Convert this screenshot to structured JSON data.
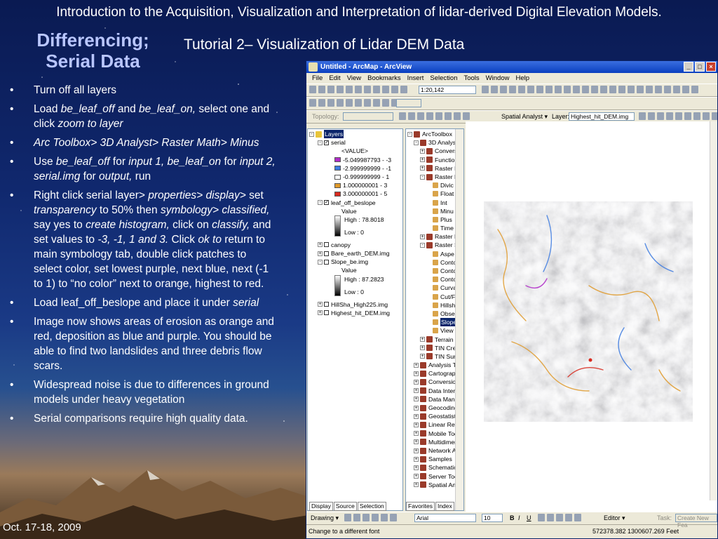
{
  "slide": {
    "top_title": "Introduction to the Acquisition, Visualization and Interpretation of lidar-derived Digital Elevation Models.",
    "heading_line1": "Differencing;",
    "heading_line2": "Serial Data",
    "subheading": "Tutorial 2– Visualization of Lidar DEM Data",
    "date": "Oct. 17-18, 2009"
  },
  "bullets": [
    {
      "segments": [
        {
          "t": "Turn off all layers",
          "i": false
        }
      ]
    },
    {
      "segments": [
        {
          "t": "Load ",
          "i": false
        },
        {
          "t": "be_leaf_off",
          "i": true
        },
        {
          "t": " and ",
          "i": false
        },
        {
          "t": "be_leaf_on,",
          "i": true
        },
        {
          "t": " select one and click ",
          "i": false
        },
        {
          "t": "zoom to layer",
          "i": true
        }
      ]
    },
    {
      "segments": [
        {
          "t": "Arc Toolbox>  3D Analyst>  Raster Math> Minus",
          "i": true
        }
      ]
    },
    {
      "segments": [
        {
          "t": "Use ",
          "i": false
        },
        {
          "t": "be_leaf_off",
          "i": true
        },
        {
          "t": " for ",
          "i": false
        },
        {
          "t": "input 1, be_leaf_on",
          "i": true
        },
        {
          "t": " for ",
          "i": false
        },
        {
          "t": "input 2, serial.img",
          "i": true
        },
        {
          "t": " for ",
          "i": false
        },
        {
          "t": "output,",
          "i": true
        },
        {
          "t": " run",
          "i": false
        }
      ]
    },
    {
      "segments": [
        {
          "t": "Right click serial layer> ",
          "i": false
        },
        {
          "t": "properties> display>",
          "i": true
        },
        {
          "t": " set ",
          "i": false
        },
        {
          "t": "transparency",
          "i": true
        },
        {
          "t": " to 50% then ",
          "i": false
        },
        {
          "t": "symbology> classified,",
          "i": true
        },
        {
          "t": " say yes to ",
          "i": false
        },
        {
          "t": "create histogram,",
          "i": true
        },
        {
          "t": " click on ",
          "i": false
        },
        {
          "t": "classify,",
          "i": true
        },
        {
          "t": " and set values to ",
          "i": false
        },
        {
          "t": "-3, -1, 1 and 3.",
          "i": true
        },
        {
          "t": "  Click ",
          "i": false
        },
        {
          "t": "ok to",
          "i": true
        },
        {
          "t": " return to main symbology tab, double click patches to select color, set lowest purple, next blue, next (-1 to 1) to “no color” next to orange, highest to red.",
          "i": false
        }
      ]
    },
    {
      "segments": [
        {
          "t": "Load leaf_off_beslope and place it under ",
          "i": false
        },
        {
          "t": "serial",
          "i": true
        }
      ]
    },
    {
      "segments": [
        {
          "t": "Image now shows areas of erosion as orange and red, deposition as blue and purple. You should be able to find two landslides and three debris flow scars.",
          "i": false
        }
      ]
    },
    {
      "segments": [
        {
          "t": "Widespread noise is due to differences in ground models under heavy vegetation",
          "i": false
        }
      ]
    },
    {
      "segments": [
        {
          "t": "Serial comparisons require high quality data.",
          "i": false
        }
      ]
    }
  ],
  "arcmap": {
    "window_title": "Untitled - ArcMap - ArcView",
    "menus": [
      "File",
      "Edit",
      "View",
      "Bookmarks",
      "Insert",
      "Selection",
      "Tools",
      "Window",
      "Help"
    ],
    "scale_value": "1:20,142",
    "topology_label": "Topology:",
    "spatial_analyst_label": "Spatial Analyst ▾",
    "layer_label": "Layer:",
    "layer_value": "Highest_hit_DEM.img",
    "toc": {
      "root": "Layers",
      "serial": "serial",
      "value_field": "<VALUE>",
      "classes": [
        {
          "label": "-5.049987793 - -3",
          "color": "#b02cc8"
        },
        {
          "label": "-2.999999999 - -1",
          "color": "#3d7be0"
        },
        {
          "label": "-0.999999999 - 1",
          "color": "#ffffff"
        },
        {
          "label": "1.000000001 - 3",
          "color": "#e09a2a"
        },
        {
          "label": "3.000000001 - 5",
          "color": "#d82a1e"
        }
      ],
      "beslope": "leaf_off_beslope",
      "value_label": "Value",
      "beslope_high": "High : 78.8018",
      "beslope_low": "Low : 0",
      "canopy": "canopy",
      "bare_earth": "Bare_earth_DEM.img",
      "slope_be": "Slope_be.img",
      "slope_high": "High : 87.2823",
      "slope_low": "Low : 0",
      "hillsha": "HillSha_High225.img",
      "highest_hit": "Highest_hit_DEM.img",
      "tabs": [
        "Display",
        "Source",
        "Selection"
      ]
    },
    "toolbox": {
      "root": "ArcToolbox",
      "items": [
        {
          "label": "3D Analyst",
          "level": 1,
          "kind": "tb",
          "exp": "-"
        },
        {
          "label": "Convers",
          "level": 2,
          "kind": "tb",
          "exp": "+"
        },
        {
          "label": "Function",
          "level": 2,
          "kind": "tb",
          "exp": "+"
        },
        {
          "label": "Raster I",
          "level": 2,
          "kind": "tb",
          "exp": "+"
        },
        {
          "label": "Raster M",
          "level": 2,
          "kind": "tb",
          "exp": "-"
        },
        {
          "label": "Divic",
          "level": 3,
          "kind": "tool",
          "exp": ""
        },
        {
          "label": "Float",
          "level": 3,
          "kind": "tool",
          "exp": ""
        },
        {
          "label": "Int",
          "level": 3,
          "kind": "tool",
          "exp": ""
        },
        {
          "label": "Minu",
          "level": 3,
          "kind": "tool",
          "exp": ""
        },
        {
          "label": "Plus",
          "level": 3,
          "kind": "tool",
          "exp": ""
        },
        {
          "label": "Time",
          "level": 3,
          "kind": "tool",
          "exp": ""
        },
        {
          "label": "Raster F",
          "level": 2,
          "kind": "tb",
          "exp": "+"
        },
        {
          "label": "Raster S",
          "level": 2,
          "kind": "tb",
          "exp": "-"
        },
        {
          "label": "Aspe",
          "level": 3,
          "kind": "tool",
          "exp": ""
        },
        {
          "label": "Conto",
          "level": 3,
          "kind": "tool",
          "exp": ""
        },
        {
          "label": "Conto",
          "level": 3,
          "kind": "tool",
          "exp": ""
        },
        {
          "label": "Conto",
          "level": 3,
          "kind": "tool",
          "exp": ""
        },
        {
          "label": "Curva",
          "level": 3,
          "kind": "tool",
          "exp": ""
        },
        {
          "label": "Cut/F",
          "level": 3,
          "kind": "tool",
          "exp": ""
        },
        {
          "label": "Hillsh",
          "level": 3,
          "kind": "tool",
          "exp": ""
        },
        {
          "label": "Obse",
          "level": 3,
          "kind": "tool",
          "exp": ""
        },
        {
          "label": "Slope",
          "level": 3,
          "kind": "tool",
          "exp": "",
          "selected": true
        },
        {
          "label": "View",
          "level": 3,
          "kind": "tool",
          "exp": ""
        },
        {
          "label": "Terrain",
          "level": 2,
          "kind": "tb",
          "exp": "+"
        },
        {
          "label": "TIN Cre",
          "level": 2,
          "kind": "tb",
          "exp": "+"
        },
        {
          "label": "TIN Sur",
          "level": 2,
          "kind": "tb",
          "exp": "+"
        },
        {
          "label": "Analysis To",
          "level": 1,
          "kind": "tb",
          "exp": "+"
        },
        {
          "label": "Cartograph",
          "level": 1,
          "kind": "tb",
          "exp": "+"
        },
        {
          "label": "Conversion",
          "level": 1,
          "kind": "tb",
          "exp": "+"
        },
        {
          "label": "Data Interc",
          "level": 1,
          "kind": "tb",
          "exp": "+"
        },
        {
          "label": "Data Mana",
          "level": 1,
          "kind": "tb",
          "exp": "+"
        },
        {
          "label": "Geocoding",
          "level": 1,
          "kind": "tb",
          "exp": "+"
        },
        {
          "label": "Geostatistic",
          "level": 1,
          "kind": "tb",
          "exp": "+"
        },
        {
          "label": "Linear Refe",
          "level": 1,
          "kind": "tb",
          "exp": "+"
        },
        {
          "label": "Mobile Toc",
          "level": 1,
          "kind": "tb",
          "exp": "+"
        },
        {
          "label": "Multidimer",
          "level": 1,
          "kind": "tb",
          "exp": "+"
        },
        {
          "label": "Network Ar",
          "level": 1,
          "kind": "tb",
          "exp": "+"
        },
        {
          "label": "Samples",
          "level": 1,
          "kind": "tb",
          "exp": "+"
        },
        {
          "label": "Schematics",
          "level": 1,
          "kind": "tb",
          "exp": "+"
        },
        {
          "label": "Server Toc",
          "level": 1,
          "kind": "tb",
          "exp": "+"
        },
        {
          "label": "Spatial Ana",
          "level": 1,
          "kind": "tb",
          "exp": "+"
        }
      ],
      "tabs": [
        "Favorites",
        "Index"
      ]
    },
    "drawing_label": "Drawing ▾",
    "font_value": "Arial",
    "font_size_value": "10",
    "bold": "B",
    "italic": "I",
    "underline": "U",
    "editor_label": "Editor ▾",
    "task_label": "Task:",
    "task_value": "Create New Fea",
    "status_text": "Change to a different font",
    "coordinates": "572378.382  1300607.269 Feet"
  }
}
